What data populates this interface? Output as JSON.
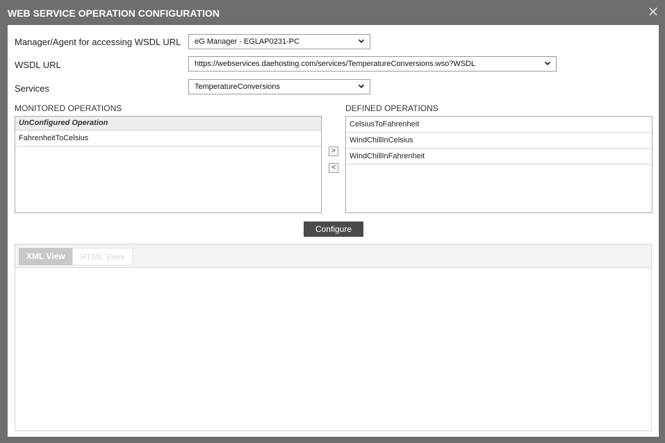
{
  "dialog": {
    "title": "WEB SERVICE OPERATION CONFIGURATION",
    "close_icon": "close-icon"
  },
  "form": {
    "manager_label": "Manager/Agent for accessing WSDL URL",
    "manager_value": "eG Manager - EGLAP0231-PC",
    "wsdl_label": "WSDL URL",
    "wsdl_value": "https://webservices.daehosting.com/services/TemperatureConversions.wso?WSDL",
    "services_label": "Services",
    "services_value": "TemperatureConversions"
  },
  "monitored": {
    "label": "MONITORED OPERATIONS",
    "group": "UnConfigured Operation",
    "items": [
      "FahrenheitToCelsius"
    ]
  },
  "defined": {
    "label": "DEFINED OPERATIONS",
    "items": [
      "CelsiusToFahrenheit",
      "WindChillInCelsius",
      "WindChillInFahrenheit"
    ]
  },
  "transfer": {
    "move_right_glyph": ">",
    "move_left_glyph": "<"
  },
  "configure_label": "Configure",
  "viewer": {
    "tabs": [
      "XML View",
      "HTML View"
    ],
    "active_tab": "XML View"
  }
}
